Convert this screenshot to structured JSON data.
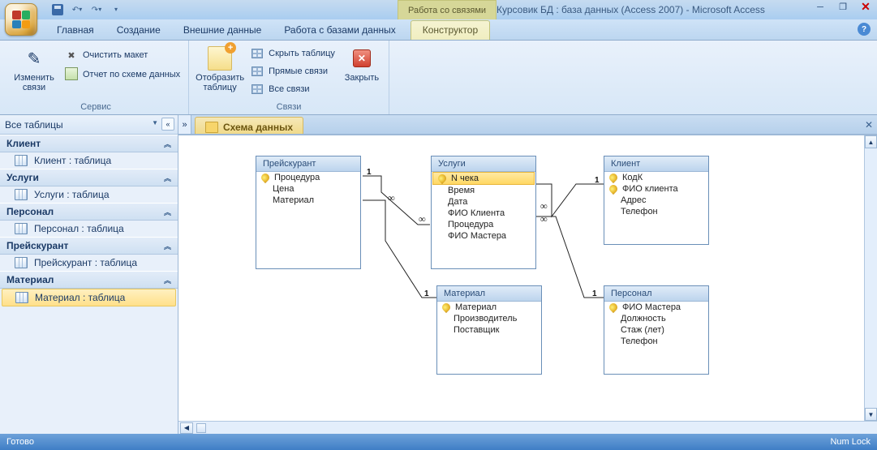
{
  "titlebar": {
    "context_group": "Работа со связями",
    "title": "Курсовик БД : база данных (Access 2007) - Microsoft Access"
  },
  "tabs": {
    "items": [
      "Главная",
      "Создание",
      "Внешние данные",
      "Работа с базами данных"
    ],
    "context_tab": "Конструктор"
  },
  "ribbon": {
    "group_tools": {
      "label": "Сервис",
      "edit_relations": "Изменить связи",
      "clear_layout": "Очистить макет",
      "schema_report": "Отчет по схеме данных"
    },
    "group_relations": {
      "label": "Связи",
      "show_table": "Отобразить таблицу",
      "hide_table": "Скрыть таблицу",
      "direct_relations": "Прямые связи",
      "all_relations": "Все связи",
      "close": "Закрыть"
    }
  },
  "nav": {
    "header": "Все таблицы",
    "groups": [
      {
        "title": "Клиент",
        "item": "Клиент : таблица"
      },
      {
        "title": "Услуги",
        "item": "Услуги : таблица"
      },
      {
        "title": "Персонал",
        "item": "Персонал : таблица"
      },
      {
        "title": "Прейскурант",
        "item": "Прейскурант : таблица"
      },
      {
        "title": "Материал",
        "item": "Материал : таблица"
      }
    ]
  },
  "document": {
    "tab_title": "Схема данных"
  },
  "tables": {
    "preiskurant": {
      "title": "Прейскурант",
      "fields": [
        "Процедура",
        "Цена",
        "Материал"
      ]
    },
    "uslugi": {
      "title": "Услуги",
      "fields": [
        "N чека",
        "Время",
        "Дата",
        "ФИО Клиента",
        "Процедура",
        "ФИО Мастера"
      ]
    },
    "klient": {
      "title": "Клиент",
      "fields": [
        "КодК",
        "ФИО клиента",
        "Адрес",
        "Телефон"
      ]
    },
    "material": {
      "title": "Материал",
      "fields": [
        "Материал",
        "Производитель",
        "Поставщик"
      ]
    },
    "personal": {
      "title": "Персонал",
      "fields": [
        "ФИО Мастера",
        "Должность",
        "Стаж (лет)",
        "Телефон"
      ]
    }
  },
  "relations": {
    "one": "1",
    "many": "∞"
  },
  "status": {
    "left": "Готово",
    "right": "Num Lock"
  }
}
